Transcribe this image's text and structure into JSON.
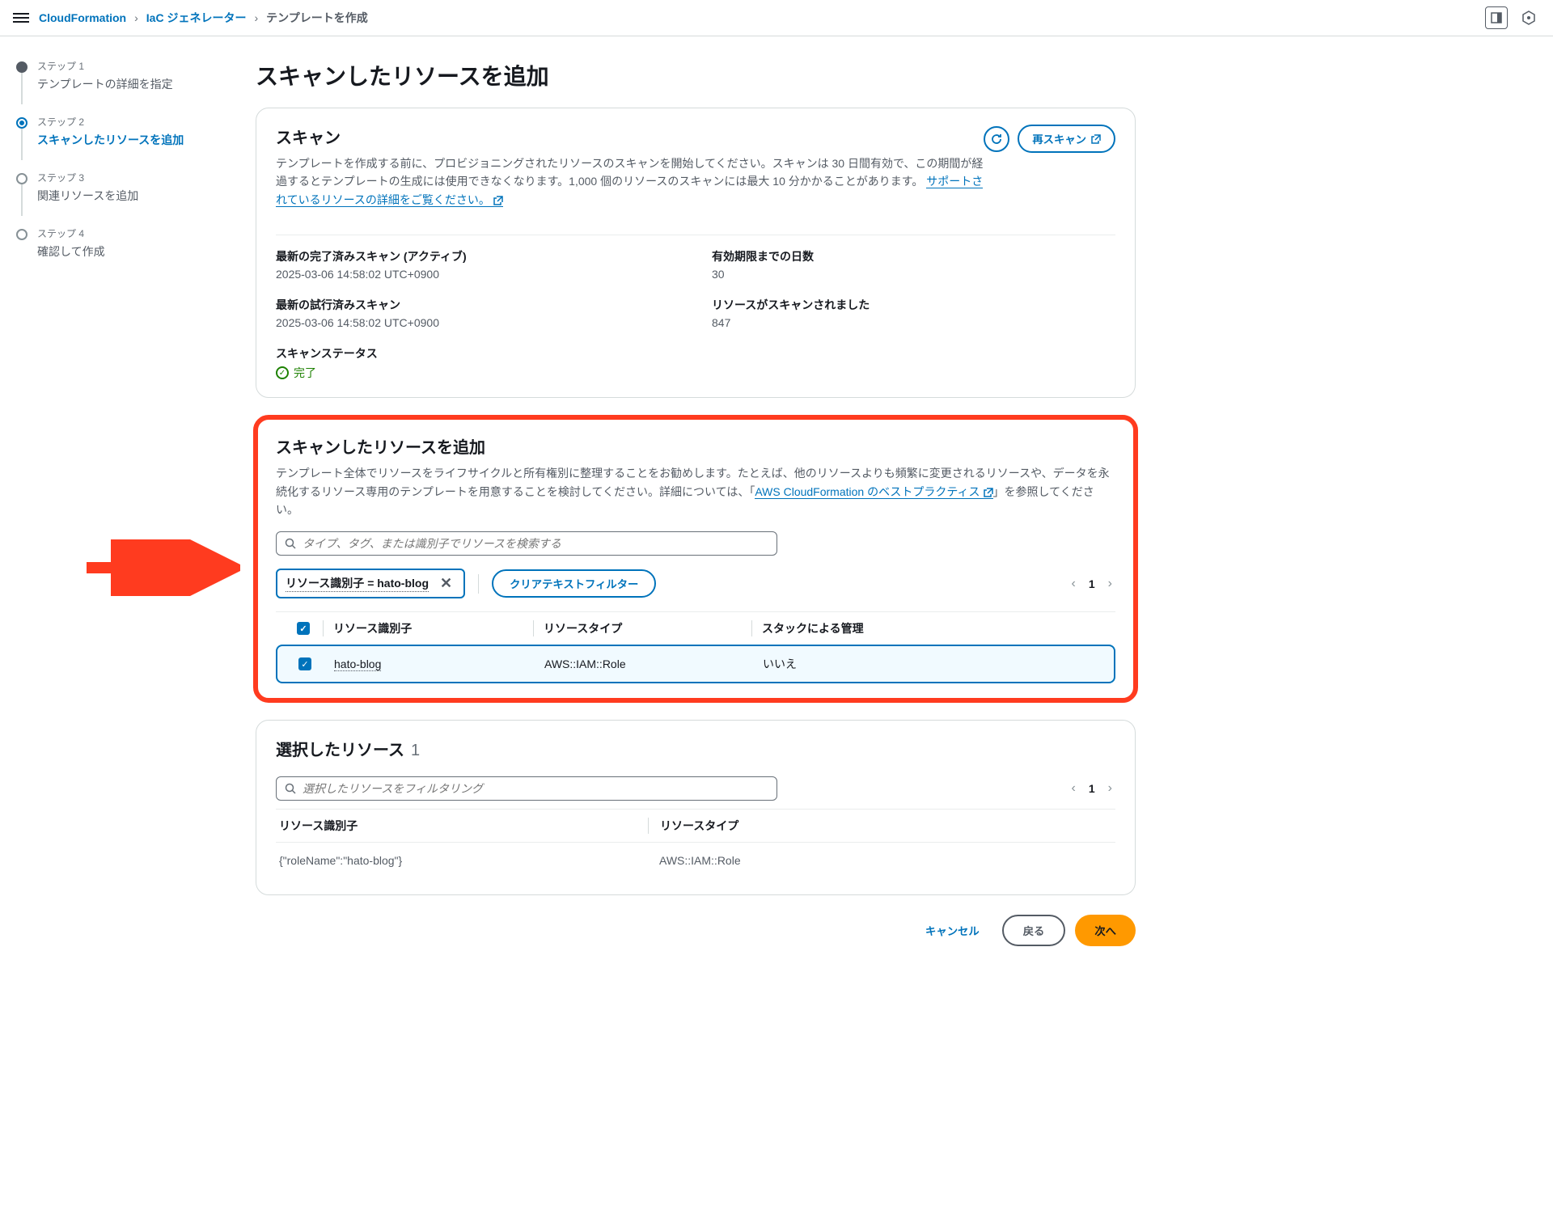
{
  "breadcrumb": {
    "root": "CloudFormation",
    "mid": "IaC ジェネレーター",
    "current": "テンプレートを作成"
  },
  "steps": [
    {
      "num": "ステップ 1",
      "label": "テンプレートの詳細を指定"
    },
    {
      "num": "ステップ 2",
      "label": "スキャンしたリソースを追加"
    },
    {
      "num": "ステップ 3",
      "label": "関連リソースを追加"
    },
    {
      "num": "ステップ 4",
      "label": "確認して作成"
    }
  ],
  "page_title": "スキャンしたリソースを追加",
  "scan_panel": {
    "title": "スキャン",
    "description_pre": "テンプレートを作成する前に、プロビジョニングされたリソースのスキャンを開始してください。スキャンは 30 日間有効で、この期間が経過するとテンプレートの生成には使用できなくなります。1,000 個のリソースのスキャンには最大 10 分かかることがあります。",
    "link": "サポートされているリソースの詳細をご覧ください。",
    "rescan_btn": "再スキャン",
    "fields": {
      "last_completed_label": "最新の完了済みスキャン (アクティブ)",
      "last_completed_value": "2025-03-06 14:58:02 UTC+0900",
      "days_left_label": "有効期限までの日数",
      "days_left_value": "30",
      "last_attempted_label": "最新の試行済みスキャン",
      "last_attempted_value": "2025-03-06 14:58:02 UTC+0900",
      "resources_scanned_label": "リソースがスキャンされました",
      "resources_scanned_value": "847",
      "status_label": "スキャンステータス",
      "status_value": "完了"
    }
  },
  "add_panel": {
    "title": "スキャンしたリソースを追加",
    "description_pre": "テンプレート全体でリソースをライフサイクルと所有権別に整理することをお勧めします。たとえば、他のリソースよりも頻繁に変更されるリソースや、データを永続化するリソース専用のテンプレートを用意することを検討してください。詳細については、「",
    "link": "AWS CloudFormation のベストプラクティス",
    "description_post": "」を参照してください。",
    "search_placeholder": "タイプ、タグ、または識別子でリソースを検索する",
    "filter_tag": "リソース識別子 = hato-blog",
    "clear_filter_btn": "クリアテキストフィルター",
    "page_num": "1",
    "columns": {
      "id": "リソース識別子",
      "type": "リソースタイプ",
      "stack": "スタックによる管理"
    },
    "row": {
      "id": "hato-blog",
      "type": "AWS::IAM::Role",
      "stack": "いいえ"
    }
  },
  "selected_panel": {
    "title": "選択したリソース",
    "count": "1",
    "search_placeholder": "選択したリソースをフィルタリング",
    "page_num": "1",
    "columns": {
      "id": "リソース識別子",
      "type": "リソースタイプ"
    },
    "row": {
      "id": "{\"roleName\":\"hato-blog\"}",
      "type": "AWS::IAM::Role"
    }
  },
  "footer": {
    "cancel": "キャンセル",
    "back": "戻る",
    "next": "次へ"
  }
}
